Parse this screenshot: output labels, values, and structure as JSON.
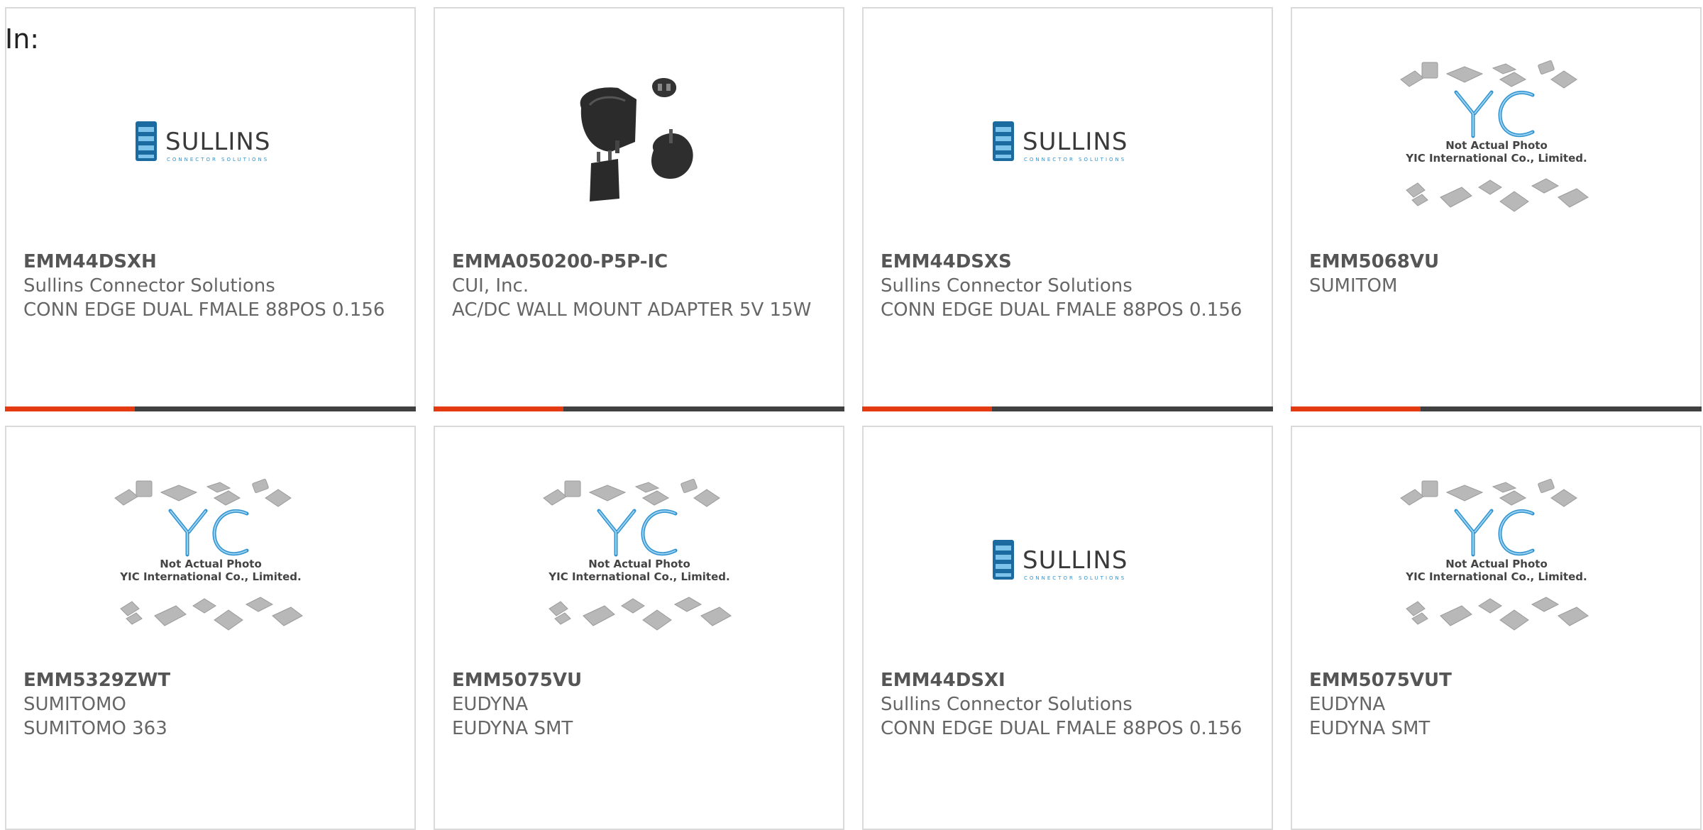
{
  "filter_label": "In:",
  "colors": {
    "accent": "#e33a12",
    "bar": "#404040",
    "sullins_blue": "#1b6aa0",
    "yic_blue": "#2f93d0"
  },
  "products": [
    {
      "part": "EMM44DSXH",
      "mfr": "Sullins Connector Solutions",
      "desc": "CONN EDGE DUAL FMALE 88POS 0.156",
      "image": "sullins-logo"
    },
    {
      "part": "EMMA050200-P5P-IC",
      "mfr": "CUI, Inc.",
      "desc": "AC/DC WALL MOUNT ADAPTER 5V 15W",
      "image": "wall-adapter-photo"
    },
    {
      "part": "EMM44DSXS",
      "mfr": "Sullins Connector Solutions",
      "desc": "CONN EDGE DUAL FMALE 88POS 0.156",
      "image": "sullins-logo"
    },
    {
      "part": "EMM5068VU",
      "mfr": "SUMITOM",
      "desc": "",
      "image": "yic-placeholder"
    },
    {
      "part": "EMM5329ZWT",
      "mfr": "SUMITOMO",
      "desc": "SUMITOMO 363",
      "image": "yic-placeholder"
    },
    {
      "part": "EMM5075VU",
      "mfr": "EUDYNA",
      "desc": "EUDYNA SMT",
      "image": "yic-placeholder"
    },
    {
      "part": "EMM44DSXI",
      "mfr": "Sullins Connector Solutions",
      "desc": "CONN EDGE DUAL FMALE 88POS 0.156",
      "image": "sullins-logo"
    },
    {
      "part": "EMM5075VUT",
      "mfr": "EUDYNA",
      "desc": "EUDYNA SMT",
      "image": "yic-placeholder"
    }
  ],
  "yic": {
    "line1": "Not Actual Photo",
    "line2": "YIC International Co., Limited."
  },
  "sullins": {
    "name": "SULLINS",
    "tagline": "CONNECTOR SOLUTIONS"
  }
}
